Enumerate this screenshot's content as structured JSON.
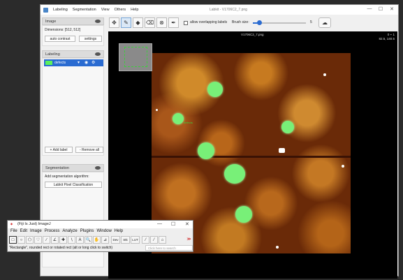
{
  "labkit": {
    "title": "Labkit - V1706C2_7.png",
    "menu": [
      "Labeling",
      "Segmentation",
      "View",
      "Others",
      "Help"
    ],
    "window_controls": [
      "—",
      "☐",
      "✕"
    ],
    "image_panel": {
      "header": "Image",
      "dimensions": "Dimensions: [512, 512]",
      "auto_contrast": "auto contrast",
      "settings": "settings"
    },
    "labeling_panel": {
      "header": "Labeling",
      "label_name": "defects",
      "label_color": "#5cf05c",
      "add_label": "+ Add label",
      "remove_all": "- Remove all"
    },
    "segmentation_panel": {
      "header": "Segmentation",
      "add_algorithm": "Add segmentation algorithm:",
      "pixel_classification": "Labkit Pixel Classification"
    },
    "toolbar": {
      "tools": [
        "move-icon",
        "pencil-icon",
        "flood-fill-icon",
        "eraser-icon",
        "remove-label-icon",
        "picker-icon"
      ],
      "allow_overlap": "allow overlapping labels",
      "brush_label": "Brush size:",
      "brush_value": "5"
    },
    "canvas": {
      "image_name": "V1706C2_7.png",
      "zoom": "0  ⌁ 1",
      "coords": "82.5,   140.5",
      "tooltip": "defects"
    }
  },
  "fiji": {
    "title": "(Fiji Is Just) ImageJ",
    "menu": [
      "File",
      "Edit",
      "Image",
      "Process",
      "Analyze",
      "Plugins",
      "Window",
      "Help"
    ],
    "window_controls": [
      "—",
      "☐",
      "✕"
    ],
    "tools": [
      "□",
      "○",
      "⬠",
      "♡",
      "∕",
      "∠",
      "✚",
      "∖",
      "A",
      "🔍",
      "✋",
      "⊿",
      "Dev",
      "Stk",
      "LUT",
      "⁄",
      "⁄",
      "⌂",
      "≫"
    ],
    "status": "\"Rectangle\", rounded rect or rotated rect (alt or long click to switch)",
    "search_placeholder": "Click here to search"
  }
}
